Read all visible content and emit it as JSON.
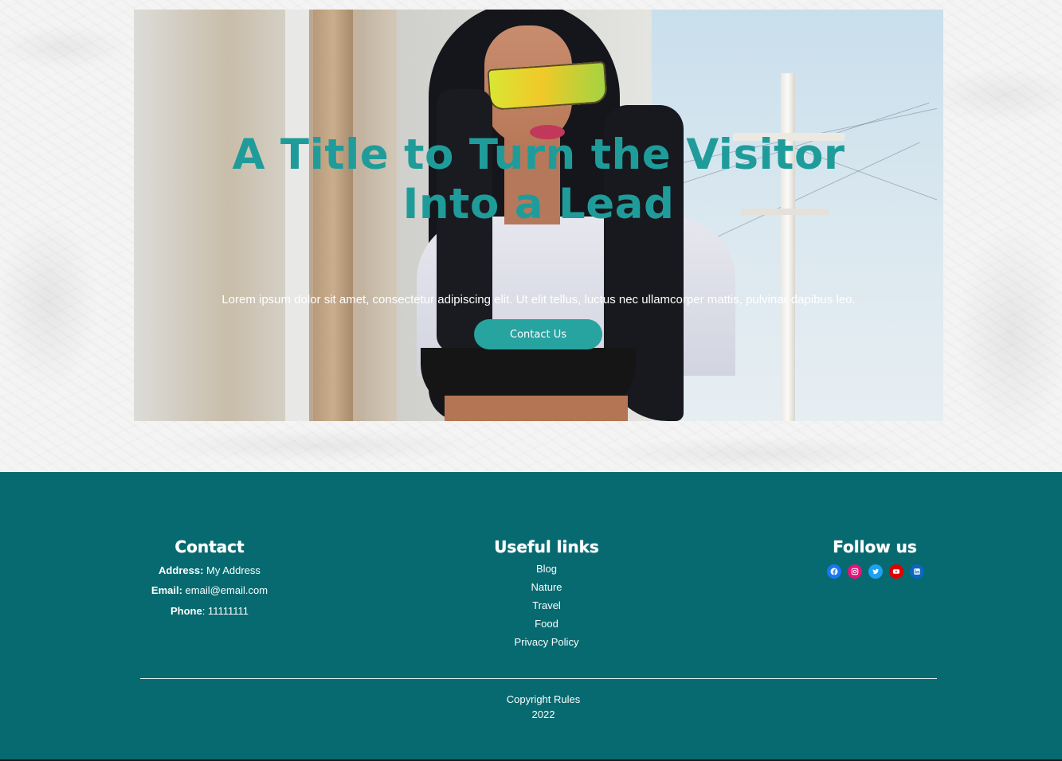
{
  "hero": {
    "title": "A Title to Turn the Visitor Into a Lead",
    "text": "Lorem ipsum dolor sit amet, consectetur adipiscing elit. Ut elit tellus, luctus nec ullamcorper mattis, pulvinar dapibus leo.",
    "button_label": "Contact Us",
    "accent_color": "#1f9c9a"
  },
  "footer": {
    "background_color": "#066a70",
    "contact": {
      "title": "Contact",
      "address_label": "Address:",
      "address_value": " My Address",
      "email_label": "Email:",
      "email_value": " email@email.com",
      "phone_label": "Phone",
      "phone_value": ": 11111111"
    },
    "links": {
      "title": "Useful links",
      "items": [
        "Blog",
        "Nature",
        "Travel",
        "Food",
        "Privacy Policy"
      ]
    },
    "follow": {
      "title": "Follow us",
      "icons": [
        {
          "name": "facebook-icon",
          "color": "#1877f2"
        },
        {
          "name": "instagram-icon",
          "color": "#e4137a"
        },
        {
          "name": "twitter-icon",
          "color": "#1da1f2"
        },
        {
          "name": "youtube-icon",
          "color": "#e00000"
        },
        {
          "name": "linkedin-icon",
          "color": "#0a66c2"
        }
      ]
    },
    "copyright_line1": "Copyright Rules",
    "copyright_line2": "2022"
  }
}
